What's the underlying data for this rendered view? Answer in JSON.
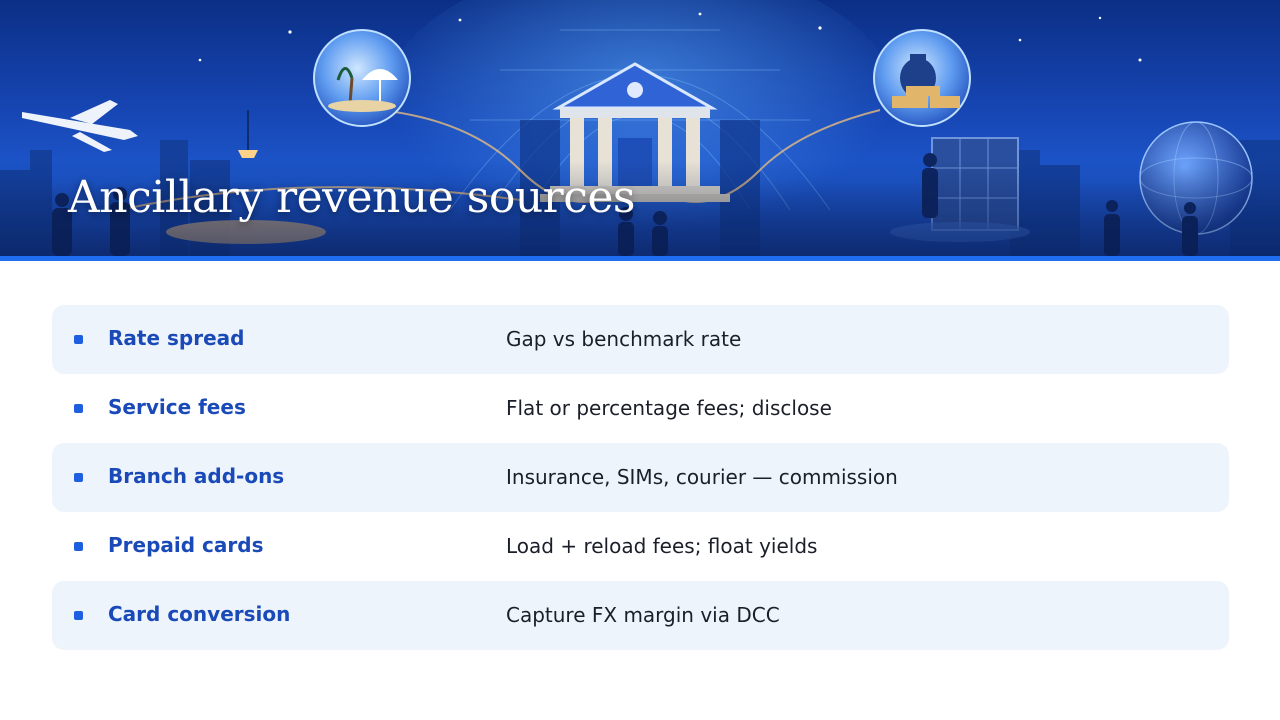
{
  "slide": {
    "title": "Ancillary revenue sources"
  },
  "colors": {
    "accent": "#1f6df0",
    "label": "#1a49b8",
    "row_fill": "#eef4fc",
    "text": "#1b1f2a"
  },
  "hero_icons": [
    "airplane-icon",
    "beach-umbrella-icon",
    "bank-building-icon",
    "money-bag-icon",
    "gold-bars-icon",
    "lockers-icon",
    "globe-icon",
    "people-icon"
  ],
  "rows": [
    {
      "label": "Rate spread",
      "desc": "Gap vs benchmark rate",
      "shaded": true
    },
    {
      "label": "Service fees",
      "desc": "Flat or percentage fees; disclose",
      "shaded": false
    },
    {
      "label": "Branch add-ons",
      "desc": "Insurance, SIMs, courier — commission",
      "shaded": true
    },
    {
      "label": "Prepaid cards",
      "desc": "Load + reload fees; float yields",
      "shaded": false
    },
    {
      "label": "Card conversion",
      "desc": "Capture FX margin via DCC",
      "shaded": true
    }
  ]
}
